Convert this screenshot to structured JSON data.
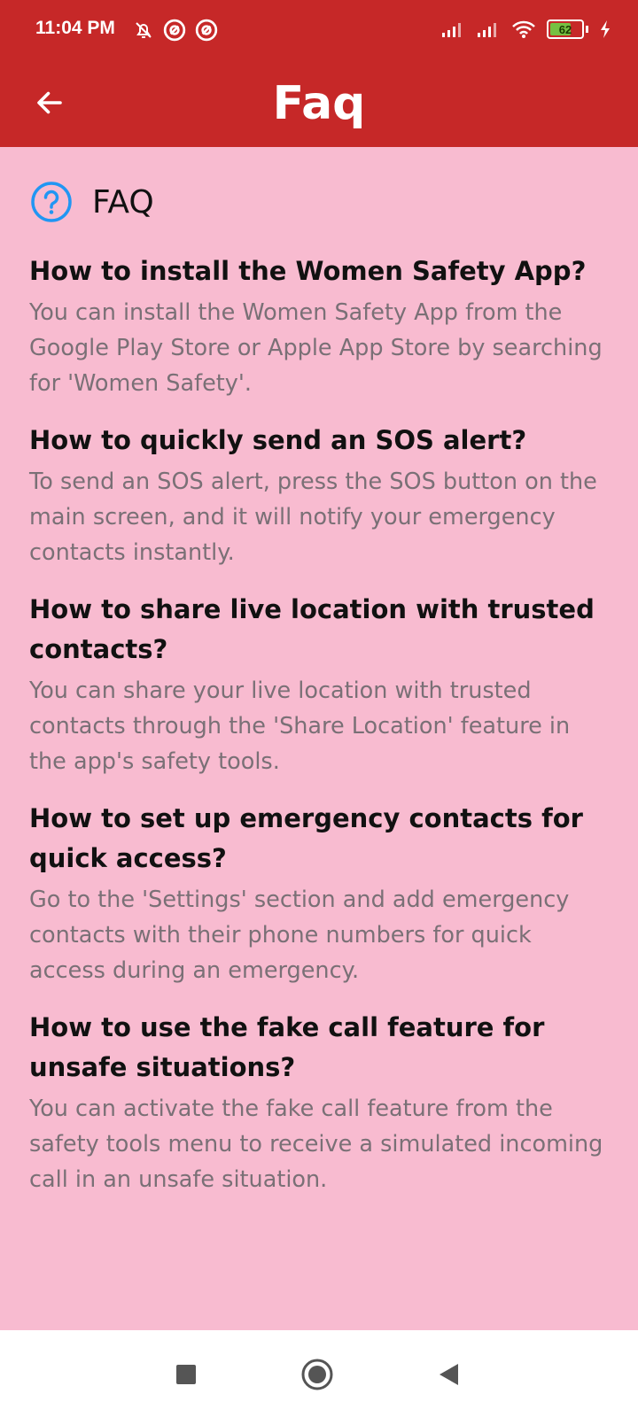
{
  "status_bar": {
    "time": "11:04 PM",
    "battery_level": "62"
  },
  "app_bar": {
    "title": "Faq",
    "back_icon": "arrow-left-icon"
  },
  "faq_section": {
    "header": "FAQ",
    "icon": "help-circle-icon",
    "items": [
      {
        "question": "How to install the Women Safety App?",
        "answer": "You can install the Women Safety App from the Google Play Store or Apple App Store by searching for 'Women Safety'."
      },
      {
        "question": "How to quickly send an SOS alert?",
        "answer": "To send an SOS alert, press the SOS button on the main screen, and it will notify your emergency contacts instantly."
      },
      {
        "question": "How to share live location with trusted contacts?",
        "answer": "You can share your live location with trusted contacts through the 'Share Location' feature in the app's safety tools."
      },
      {
        "question": "How to set up emergency contacts for quick access?",
        "answer": "Go to the 'Settings' section and add emergency contacts with their phone numbers for quick access during an emergency."
      },
      {
        "question": "How to use the fake call feature for unsafe situations?",
        "answer": "You can activate the fake call feature from the safety tools menu to receive a simulated incoming call in an unsafe situation."
      }
    ]
  },
  "colors": {
    "app_bar": "#c62828",
    "background": "#f8bbd0",
    "question_text": "#111111",
    "answer_text": "#7a7076",
    "icon_blue": "#2196f3"
  }
}
